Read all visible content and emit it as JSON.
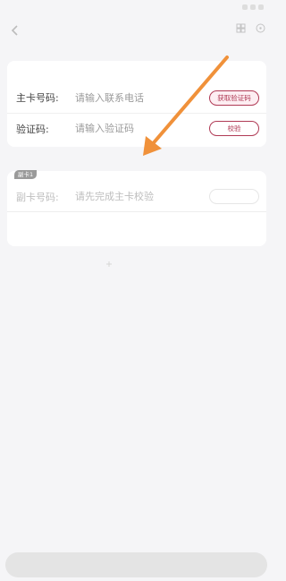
{
  "status_bar": {
    "time": "",
    "right": ""
  },
  "nav": {
    "back_icon": "chevron-left-icon",
    "title": "",
    "subtitle": "",
    "actions": [
      "grid-icon",
      "more-icon"
    ]
  },
  "primary_card": {
    "header": "",
    "card_number": {
      "label": "主卡号码:",
      "placeholder": "请输入联系电话",
      "button": "获取验证码"
    },
    "verification": {
      "label": "验证码:",
      "placeholder": "请输入验证码",
      "button": "校验"
    }
  },
  "secondary_card": {
    "badge": "副卡1",
    "card_number": {
      "label": "副卡号码:",
      "placeholder": "请先完成主卡校验",
      "button": ""
    },
    "hint": ""
  },
  "add_card": {
    "icon": "plus-icon",
    "label": ""
  },
  "bottom_button": {
    "label": ""
  },
  "annotation": {
    "type": "arrow",
    "color": "#f0913a"
  },
  "colors": {
    "accent": "#b03a55",
    "background": "#f5f5f7",
    "annotation": "#f0913a"
  }
}
